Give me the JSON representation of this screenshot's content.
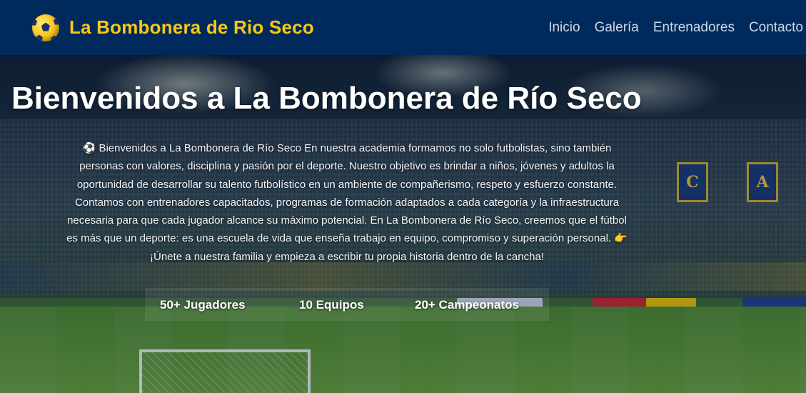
{
  "header": {
    "brand_name": "La Bombonera de Rio Seco",
    "logo_icon": "soccer-ball-icon",
    "nav": [
      {
        "label": "Inicio"
      },
      {
        "label": "Galería"
      },
      {
        "label": "Entrenadores"
      },
      {
        "label": "Contacto"
      }
    ]
  },
  "hero": {
    "title": "Bienvenidos a La Bombonera de Río Seco",
    "text": "⚽ Bienvenidos a La Bombonera de Río Seco En nuestra academia formamos no solo futbolistas, sino también personas con valores, disciplina y pasión por el deporte. Nuestro objetivo es brindar a niños, jóvenes y adultos la oportunidad de desarrollar su talento futbolístico en un ambiente de compañerismo, respeto y esfuerzo constante. Contamos con entrenadores capacitados, programas de formación adaptados a cada categoría y la infraestructura necesaria para que cada jugador alcance su máximo potencial. En La Bombonera de Río Seco, creemos que el fútbol es más que un deporte: es una escuela de vida que enseña trabajo en equipo, compromiso y superación personal. 👉 ¡Únete a nuestra familia y empieza a escribir tu propia historia dentro de la cancha!",
    "stats": [
      {
        "label": "50+ Jugadores"
      },
      {
        "label": "10 Equipos"
      },
      {
        "label": "20+ Campeonatos"
      }
    ],
    "banner_letters": [
      "C",
      "A"
    ]
  },
  "colors": {
    "navbar_bg": "#002a5c",
    "brand_yellow": "#f7c815",
    "nav_text": "#cfd8e6"
  }
}
